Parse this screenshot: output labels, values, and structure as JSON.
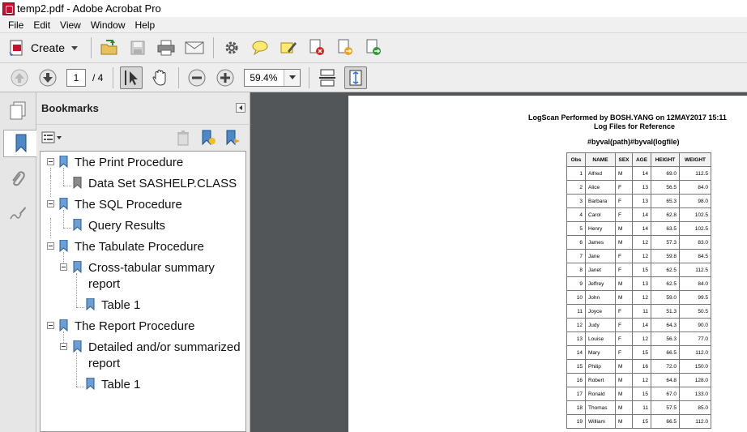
{
  "window": {
    "title": "temp2.pdf - Adobe Acrobat Pro"
  },
  "menu": [
    "File",
    "Edit",
    "View",
    "Window",
    "Help"
  ],
  "toolbar": {
    "create_label": "Create",
    "page_current": "1",
    "page_total": "/ 4",
    "zoom": "59.4%"
  },
  "bookmarks": {
    "title": "Bookmarks",
    "items": [
      {
        "label": "The Print Procedure"
      },
      {
        "label": "Data Set SASHELP.CLASS"
      },
      {
        "label": "The SQL Procedure"
      },
      {
        "label": "Query Results"
      },
      {
        "label": "The Tabulate Procedure"
      },
      {
        "label": "Cross-tabular summary"
      },
      {
        "label": "report"
      },
      {
        "label": "Table 1"
      },
      {
        "label": "The Report Procedure"
      },
      {
        "label": "Detailed and/or summarized"
      },
      {
        "label": "report"
      },
      {
        "label": "Table 1"
      }
    ]
  },
  "document": {
    "heading1": "LogScan Performed by BOSH.YANG on 12MAY2017 15:11",
    "heading2": "Log Files for Reference",
    "heading3": "#byval(path)#byval(logfile)",
    "table": {
      "columns": [
        "Obs",
        "NAME",
        "SEX",
        "AGE",
        "HEIGHT",
        "WEIGHT"
      ],
      "rows": [
        [
          "1",
          "Alfred",
          "M",
          "14",
          "69.0",
          "112.5"
        ],
        [
          "2",
          "Alice",
          "F",
          "13",
          "56.5",
          "84.0"
        ],
        [
          "3",
          "Barbara",
          "F",
          "13",
          "65.3",
          "98.0"
        ],
        [
          "4",
          "Carol",
          "F",
          "14",
          "62.8",
          "102.5"
        ],
        [
          "5",
          "Henry",
          "M",
          "14",
          "63.5",
          "102.5"
        ],
        [
          "6",
          "James",
          "M",
          "12",
          "57.3",
          "83.0"
        ],
        [
          "7",
          "Jane",
          "F",
          "12",
          "59.8",
          "84.5"
        ],
        [
          "8",
          "Janet",
          "F",
          "15",
          "62.5",
          "112.5"
        ],
        [
          "9",
          "Jeffrey",
          "M",
          "13",
          "62.5",
          "84.0"
        ],
        [
          "10",
          "John",
          "M",
          "12",
          "59.0",
          "99.5"
        ],
        [
          "11",
          "Joyce",
          "F",
          "11",
          "51.3",
          "50.5"
        ],
        [
          "12",
          "Judy",
          "F",
          "14",
          "64.3",
          "90.0"
        ],
        [
          "13",
          "Louise",
          "F",
          "12",
          "56.3",
          "77.0"
        ],
        [
          "14",
          "Mary",
          "F",
          "15",
          "66.5",
          "112.0"
        ],
        [
          "15",
          "Philip",
          "M",
          "16",
          "72.0",
          "150.0"
        ],
        [
          "16",
          "Robert",
          "M",
          "12",
          "64.8",
          "128.0"
        ],
        [
          "17",
          "Ronald",
          "M",
          "15",
          "67.0",
          "133.0"
        ],
        [
          "18",
          "Thomas",
          "M",
          "11",
          "57.5",
          "85.0"
        ],
        [
          "19",
          "William",
          "M",
          "15",
          "66.5",
          "112.0"
        ]
      ]
    }
  }
}
